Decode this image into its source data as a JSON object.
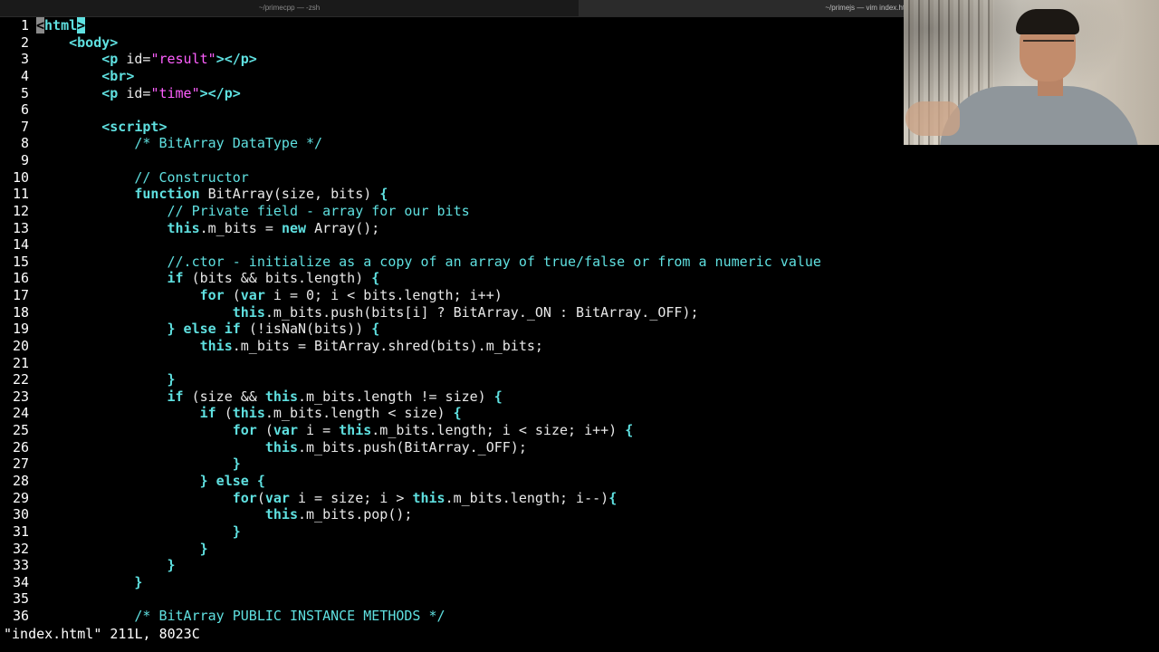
{
  "tabs": [
    {
      "label": "~/primecpp — -zsh"
    },
    {
      "label": "~/primejs — vim index.html"
    }
  ],
  "editor": {
    "lines": [
      {
        "n": "1",
        "segs": [
          {
            "c": "cursor",
            "t": "<"
          },
          {
            "c": "tag",
            "t": "html"
          },
          {
            "c": "hl",
            "t": ">"
          }
        ]
      },
      {
        "n": "2",
        "segs": [
          {
            "c": "tag",
            "t": "    <body>"
          }
        ]
      },
      {
        "n": "3",
        "segs": [
          {
            "c": "tag",
            "t": "        <p "
          },
          {
            "c": "tx",
            "t": "id="
          },
          {
            "c": "str",
            "t": "\"result\""
          },
          {
            "c": "tag",
            "t": "></p>"
          }
        ]
      },
      {
        "n": "4",
        "segs": [
          {
            "c": "tag",
            "t": "        <br>"
          }
        ]
      },
      {
        "n": "5",
        "segs": [
          {
            "c": "tag",
            "t": "        <p "
          },
          {
            "c": "tx",
            "t": "id="
          },
          {
            "c": "str",
            "t": "\"time\""
          },
          {
            "c": "tag",
            "t": "></p>"
          }
        ]
      },
      {
        "n": "6",
        "segs": []
      },
      {
        "n": "7",
        "segs": [
          {
            "c": "tag",
            "t": "        <script>"
          }
        ]
      },
      {
        "n": "8",
        "segs": [
          {
            "c": "cm",
            "t": "            /* BitArray DataType */"
          }
        ]
      },
      {
        "n": "9",
        "segs": []
      },
      {
        "n": "10",
        "segs": [
          {
            "c": "cm",
            "t": "            // Constructor"
          }
        ]
      },
      {
        "n": "11",
        "segs": [
          {
            "c": "kw",
            "t": "            function "
          },
          {
            "c": "tx",
            "t": "BitArray(size, bits) "
          },
          {
            "c": "kw",
            "t": "{"
          }
        ]
      },
      {
        "n": "12",
        "segs": [
          {
            "c": "cm",
            "t": "                // Private field - array for our bits"
          }
        ]
      },
      {
        "n": "13",
        "segs": [
          {
            "c": "kw",
            "t": "                this"
          },
          {
            "c": "tx",
            "t": ".m_bits = "
          },
          {
            "c": "kw",
            "t": "new "
          },
          {
            "c": "tx",
            "t": "Array();"
          }
        ]
      },
      {
        "n": "14",
        "segs": []
      },
      {
        "n": "15",
        "segs": [
          {
            "c": "cm",
            "t": "                //.ctor - initialize as a copy of an array of true/false or from a numeric value"
          }
        ]
      },
      {
        "n": "16",
        "segs": [
          {
            "c": "kw",
            "t": "                if "
          },
          {
            "c": "tx",
            "t": "(bits && bits.length) "
          },
          {
            "c": "kw",
            "t": "{"
          }
        ]
      },
      {
        "n": "17",
        "segs": [
          {
            "c": "kw",
            "t": "                    for "
          },
          {
            "c": "tx",
            "t": "("
          },
          {
            "c": "kw",
            "t": "var "
          },
          {
            "c": "tx",
            "t": "i = 0; i < bits.length; i++)"
          }
        ]
      },
      {
        "n": "18",
        "segs": [
          {
            "c": "kw",
            "t": "                        this"
          },
          {
            "c": "tx",
            "t": ".m_bits.push(bits[i] ? BitArray._ON : BitArray._OFF);"
          }
        ]
      },
      {
        "n": "19",
        "segs": [
          {
            "c": "kw",
            "t": "                } else if "
          },
          {
            "c": "tx",
            "t": "(!isNaN(bits)) "
          },
          {
            "c": "kw",
            "t": "{"
          }
        ]
      },
      {
        "n": "20",
        "segs": [
          {
            "c": "kw",
            "t": "                    this"
          },
          {
            "c": "tx",
            "t": ".m_bits = BitArray.shred(bits).m_bits;"
          }
        ]
      },
      {
        "n": "21",
        "segs": []
      },
      {
        "n": "22",
        "segs": [
          {
            "c": "kw",
            "t": "                }"
          }
        ]
      },
      {
        "n": "23",
        "segs": [
          {
            "c": "kw",
            "t": "                if "
          },
          {
            "c": "tx",
            "t": "(size && "
          },
          {
            "c": "kw",
            "t": "this"
          },
          {
            "c": "tx",
            "t": ".m_bits.length != size) "
          },
          {
            "c": "kw",
            "t": "{"
          }
        ]
      },
      {
        "n": "24",
        "segs": [
          {
            "c": "kw",
            "t": "                    if "
          },
          {
            "c": "tx",
            "t": "("
          },
          {
            "c": "kw",
            "t": "this"
          },
          {
            "c": "tx",
            "t": ".m_bits.length < size) "
          },
          {
            "c": "kw",
            "t": "{"
          }
        ]
      },
      {
        "n": "25",
        "segs": [
          {
            "c": "kw",
            "t": "                        for "
          },
          {
            "c": "tx",
            "t": "("
          },
          {
            "c": "kw",
            "t": "var "
          },
          {
            "c": "tx",
            "t": "i = "
          },
          {
            "c": "kw",
            "t": "this"
          },
          {
            "c": "tx",
            "t": ".m_bits.length; i < size; i++) "
          },
          {
            "c": "kw",
            "t": "{"
          }
        ]
      },
      {
        "n": "26",
        "segs": [
          {
            "c": "kw",
            "t": "                            this"
          },
          {
            "c": "tx",
            "t": ".m_bits.push(BitArray._OFF);"
          }
        ]
      },
      {
        "n": "27",
        "segs": [
          {
            "c": "kw",
            "t": "                        }"
          }
        ]
      },
      {
        "n": "28",
        "segs": [
          {
            "c": "kw",
            "t": "                    } else {"
          }
        ]
      },
      {
        "n": "29",
        "segs": [
          {
            "c": "kw",
            "t": "                        for"
          },
          {
            "c": "tx",
            "t": "("
          },
          {
            "c": "kw",
            "t": "var "
          },
          {
            "c": "tx",
            "t": "i = size; i > "
          },
          {
            "c": "kw",
            "t": "this"
          },
          {
            "c": "tx",
            "t": ".m_bits.length; i--)"
          },
          {
            "c": "kw",
            "t": "{"
          }
        ]
      },
      {
        "n": "30",
        "segs": [
          {
            "c": "kw",
            "t": "                            this"
          },
          {
            "c": "tx",
            "t": ".m_bits.pop();"
          }
        ]
      },
      {
        "n": "31",
        "segs": [
          {
            "c": "kw",
            "t": "                        }"
          }
        ]
      },
      {
        "n": "32",
        "segs": [
          {
            "c": "kw",
            "t": "                    }"
          }
        ]
      },
      {
        "n": "33",
        "segs": [
          {
            "c": "kw",
            "t": "                }"
          }
        ]
      },
      {
        "n": "34",
        "segs": [
          {
            "c": "kw",
            "t": "            }"
          }
        ]
      },
      {
        "n": "35",
        "segs": []
      },
      {
        "n": "36",
        "segs": [
          {
            "c": "cm",
            "t": "            /* BitArray PUBLIC INSTANCE METHODS */"
          }
        ]
      }
    ]
  },
  "status": {
    "text": "\"index.html\" 211L, 8023C"
  },
  "colors": {
    "keyword": "#5fe0e0",
    "string": "#ff5fff",
    "text": "#e8e8e8",
    "background": "#000000"
  }
}
